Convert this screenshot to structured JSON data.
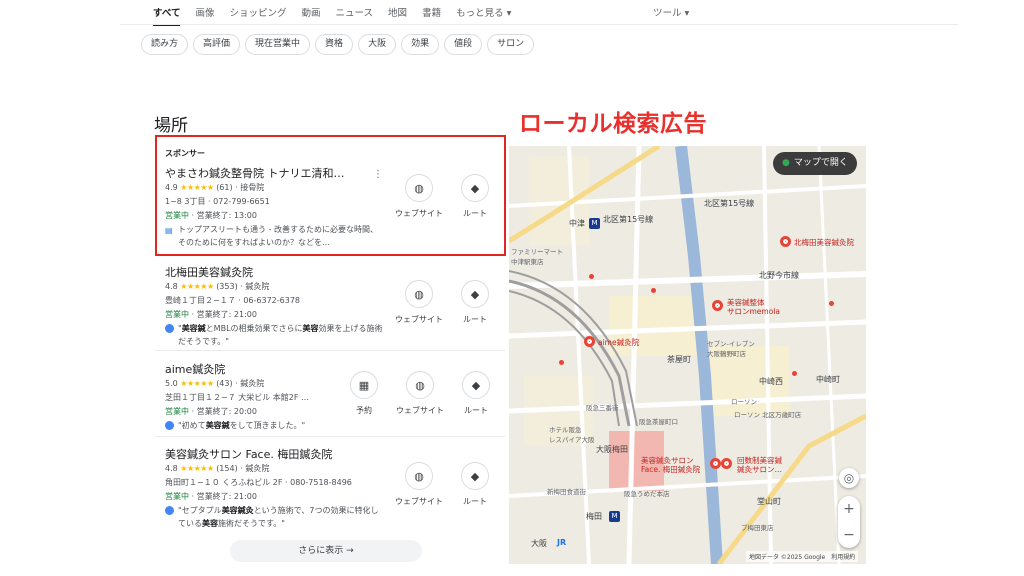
{
  "nav": {
    "tabs": [
      "すべて",
      "画像",
      "ショッピング",
      "動画",
      "ニュース",
      "地図",
      "書籍",
      "もっと見る ▾"
    ],
    "tools": "ツール ▾"
  },
  "chips": [
    "読み方",
    "高評価",
    "現在営業中",
    "資格",
    "大阪",
    "効果",
    "値段",
    "サロン"
  ],
  "places_title": "場所",
  "ad_heading": "ローカル検索広告",
  "listings": [
    {
      "sponsor": "スポンサー",
      "name": "やまさわ鍼灸整骨院 トナリエ清和…",
      "rating": "4.9",
      "stars": "★★★★★",
      "reviews": "(61)",
      "category": "· 接骨院",
      "address": "1−8 3丁目 · 072-799-6651",
      "status": "営業中",
      "hours": " · 営業終了: 13:00",
      "review_text": "トップアスリートも通う - 改善するために必要な時間、そのために何をすればよいのか？などを…"
    },
    {
      "name": "北梅田美容鍼灸院",
      "rating": "4.8",
      "stars": "★★★★★",
      "reviews": "(353)",
      "category": "· 鍼灸院",
      "address": "豊崎１丁目２−１７ · 06-6372-6378",
      "status": "営業中",
      "hours": " · 営業終了: 21:00",
      "review_pre": "\"",
      "review_bold1": "美容鍼",
      "review_mid": "とMBLの相乗効果でさらに",
      "review_bold2": "美容",
      "review_post": "効果を上げる施術だそうです。\""
    },
    {
      "name": "aime鍼灸院",
      "rating": "5.0",
      "stars": "★★★★★",
      "reviews": "(43)",
      "category": "· 鍼灸院",
      "address": "芝田１丁目１２−７ 大栄ビル 本館2F …",
      "status": "営業中",
      "hours": " · 営業終了: 20:00",
      "review_pre": "\"初めて",
      "review_bold1": "美容鍼",
      "review_post": "をして頂きました。\""
    },
    {
      "name": "美容鍼灸サロン Face. 梅田鍼灸院",
      "rating": "4.8",
      "stars": "★★★★★",
      "reviews": "(154)",
      "category": "· 鍼灸院",
      "address": "角田町１−１０ くろふねビル 2F · 080-7518-8496",
      "status": "営業中",
      "hours": " · 営業終了: 21:00",
      "review_pre": "\"セプタプル",
      "review_bold1": "美容鍼灸",
      "review_mid": "という施術で、7つの効果に特化している",
      "review_bold2": "美容",
      "review_post": "施術だそうです。\""
    }
  ],
  "actions": {
    "website": "ウェブサイト",
    "route": "ルート",
    "booking": "予約"
  },
  "more_results": "さらに表示 →",
  "map": {
    "open_button": "マップで開く",
    "attribution": "地図データ ©2025 Google　利用規約",
    "labels": {
      "nakatsu": "中津",
      "kita15": "北区第15号線",
      "kita15b": "北区第15号線",
      "kitanoimaichi": "北野今市線",
      "kitaumeda": "北梅田美容鍼灸院",
      "memola": "美容鍼整体\nサロンmemola",
      "aime": "aime鍼灸院",
      "chayamachi": "茶屋町",
      "nakazaki": "中崎西",
      "nakazakicho": "中崎町",
      "seven": "セブン-イレブン\n大阪鶴野町店",
      "lawson1": "ローソン",
      "lawson2": "ローソン 北区万歳町店",
      "hankyusanban": "阪急三番街",
      "hotel": "ホテル阪急\nレスパイア大阪",
      "chayamachi_hankyu": "阪急茶屋町口",
      "osakaumeda": "大阪梅田",
      "face": "美容鍼灸サロン\nFace. 梅田鍼灸院",
      "kaitenkai": "回数制美容鍼\n鍼灸サロン…",
      "umeda": "梅田",
      "osaka": "大阪",
      "hankyuumeda": "阪急うめだ本店",
      "tennjinbashi": "堂山町",
      "kanjo": "大阪",
      "higashiumeda": "ブ梅田東店",
      "family": "ファミリーマート\n中津駅東店",
      "yodobashi": "新梅田食道街",
      "jr": "JR"
    }
  },
  "colors": {
    "ad_red": "#e8302c",
    "open_green": "#188038",
    "star": "#fbbc04"
  }
}
